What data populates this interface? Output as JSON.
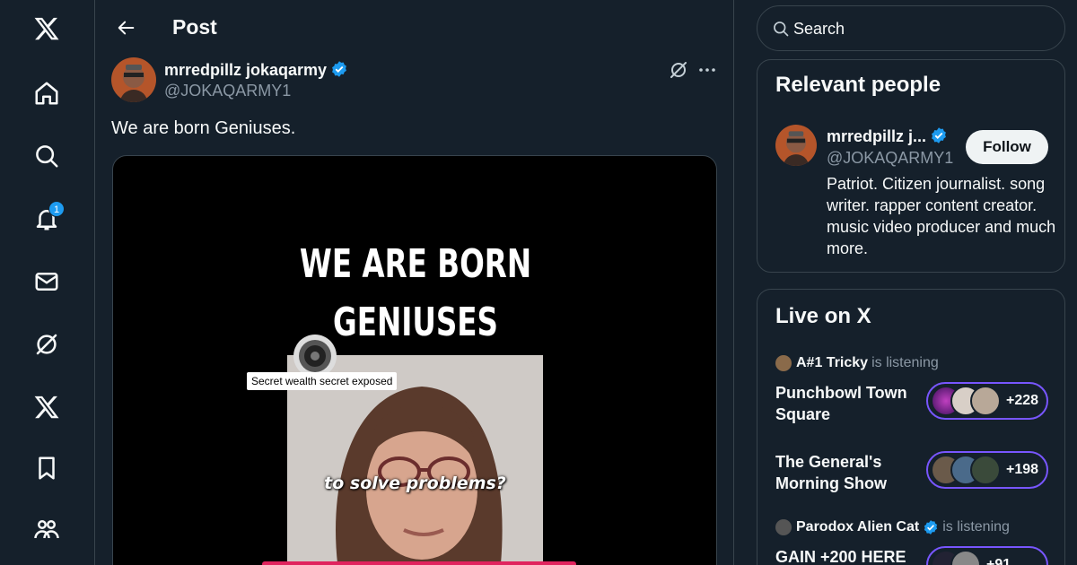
{
  "nav": {
    "items": [
      {
        "icon": "x-logo-icon"
      },
      {
        "icon": "home-icon"
      },
      {
        "icon": "explore-search-icon"
      },
      {
        "icon": "notifications-bell-icon",
        "badge": "1"
      },
      {
        "icon": "messages-envelope-icon"
      },
      {
        "icon": "grok-icon"
      },
      {
        "icon": "premium-x-icon"
      },
      {
        "icon": "bookmark-icon"
      },
      {
        "icon": "communities-icon"
      }
    ]
  },
  "header": {
    "title": "Post"
  },
  "post": {
    "author_name": "mrredpillz jokaqarmy",
    "author_handle": "@JOKAQARMY1",
    "text": "We are born Geniuses.",
    "media": {
      "headline_line1": "WE ARE BORN",
      "headline_line2": "GENIUSES",
      "caption": "to solve problems?",
      "promo_label": "Secret wealth secret exposed"
    }
  },
  "search": {
    "placeholder": "Search"
  },
  "relevant_people": {
    "title": "Relevant people",
    "name": "mrredpillz j...",
    "handle": "@JOKAQARMY1",
    "follow_label": "Follow",
    "bio": "Patriot. Citizen journalist. song writer. rapper content creator. music video producer and much more."
  },
  "live": {
    "title": "Live on X",
    "spaces": [
      {
        "host": "A#1 Tricky",
        "suffix": "is listening",
        "title": "Punchbowl Town Square",
        "count": "+228"
      },
      {
        "host": "",
        "suffix": "",
        "title": "The General's Morning Show",
        "count": "+198"
      },
      {
        "host": "Parodox Alien Cat",
        "suffix": "is listening",
        "title": "GAIN +200 HERE",
        "count": "+91"
      }
    ]
  },
  "colors": {
    "accent": "#1d9bf0",
    "background": "#15202b",
    "border": "#38444d",
    "muted": "#8b98a5",
    "space_ring": "#7856ff"
  }
}
